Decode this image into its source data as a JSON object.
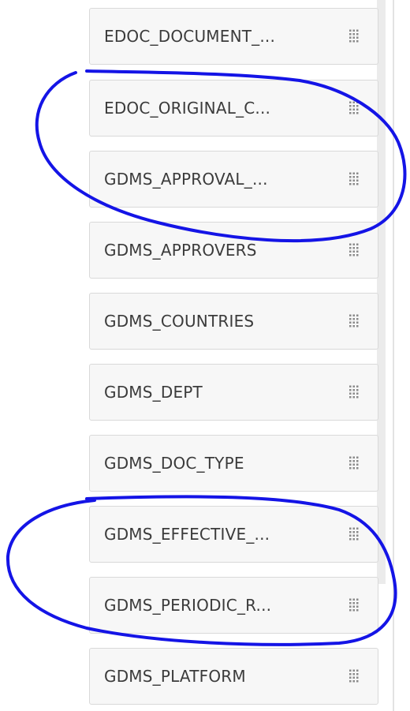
{
  "field_list": {
    "items": [
      {
        "label": "EDOC_DOCUMENT_...",
        "icon": "drag-handle-icon"
      },
      {
        "label": "EDOC_ORIGINAL_C...",
        "icon": "drag-handle-icon"
      },
      {
        "label": "GDMS_APPROVAL_...",
        "icon": "drag-handle-icon"
      },
      {
        "label": "GDMS_APPROVERS",
        "icon": "drag-handle-icon"
      },
      {
        "label": "GDMS_COUNTRIES",
        "icon": "drag-handle-icon"
      },
      {
        "label": "GDMS_DEPT",
        "icon": "drag-handle-icon"
      },
      {
        "label": "GDMS_DOC_TYPE",
        "icon": "drag-handle-icon"
      },
      {
        "label": "GDMS_EFFECTIVE_...",
        "icon": "drag-handle-icon"
      },
      {
        "label": "GDMS_PERIODIC_R...",
        "icon": "drag-handle-icon"
      },
      {
        "label": "GDMS_PLATFORM",
        "icon": "drag-handle-icon"
      }
    ]
  },
  "annotations": {
    "color": "#1414e6",
    "marks": [
      {
        "type": "hand-drawn-ellipse",
        "encloses": [
          "EDOC_ORIGINAL_C...",
          "GDMS_APPROVAL_..."
        ]
      },
      {
        "type": "hand-drawn-ellipse",
        "encloses": [
          "GDMS_EFFECTIVE_...",
          "GDMS_PERIODIC_R..."
        ]
      }
    ]
  },
  "colors": {
    "item_background": "#f7f7f7",
    "item_border": "#d9d9d9",
    "text": "#3b3b3b",
    "handle_dots": "#8a8a8a",
    "scrollbar": "#ebebeb"
  }
}
